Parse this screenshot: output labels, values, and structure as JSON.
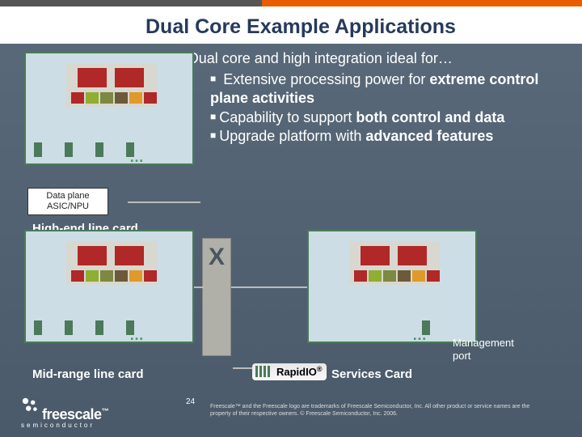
{
  "title": "Dual Core Example Applications",
  "lead": "Dual core and high integration ideal for…",
  "bullets": [
    {
      "pre": " Extensive processing power for ",
      "bold": "extreme control plane activities",
      "post": ""
    },
    {
      "pre": "Capability to support ",
      "bold": "both control and data",
      "post": ""
    },
    {
      "pre": "Upgrade platform with ",
      "bold": "advanced features",
      "post": ""
    }
  ],
  "asic_label_l1": "Data plane",
  "asic_label_l2": "ASIC/NPU",
  "card_labels": {
    "highend": "High-end line card",
    "midrange": "Mid-range line card",
    "services": "Services Card"
  },
  "mgmt_l1": "Management",
  "mgmt_l2": "port",
  "switch_x": "X",
  "rapidio": "RapidIO",
  "page_num": "24",
  "legal": "Freescale™ and the Freescale logo are trademarks of Freescale Semiconductor, Inc. All other product or service names are the property of their respective owners. © Freescale Semiconductor, Inc. 2006.",
  "brand": "freescale",
  "brand_sub": "semiconductor"
}
